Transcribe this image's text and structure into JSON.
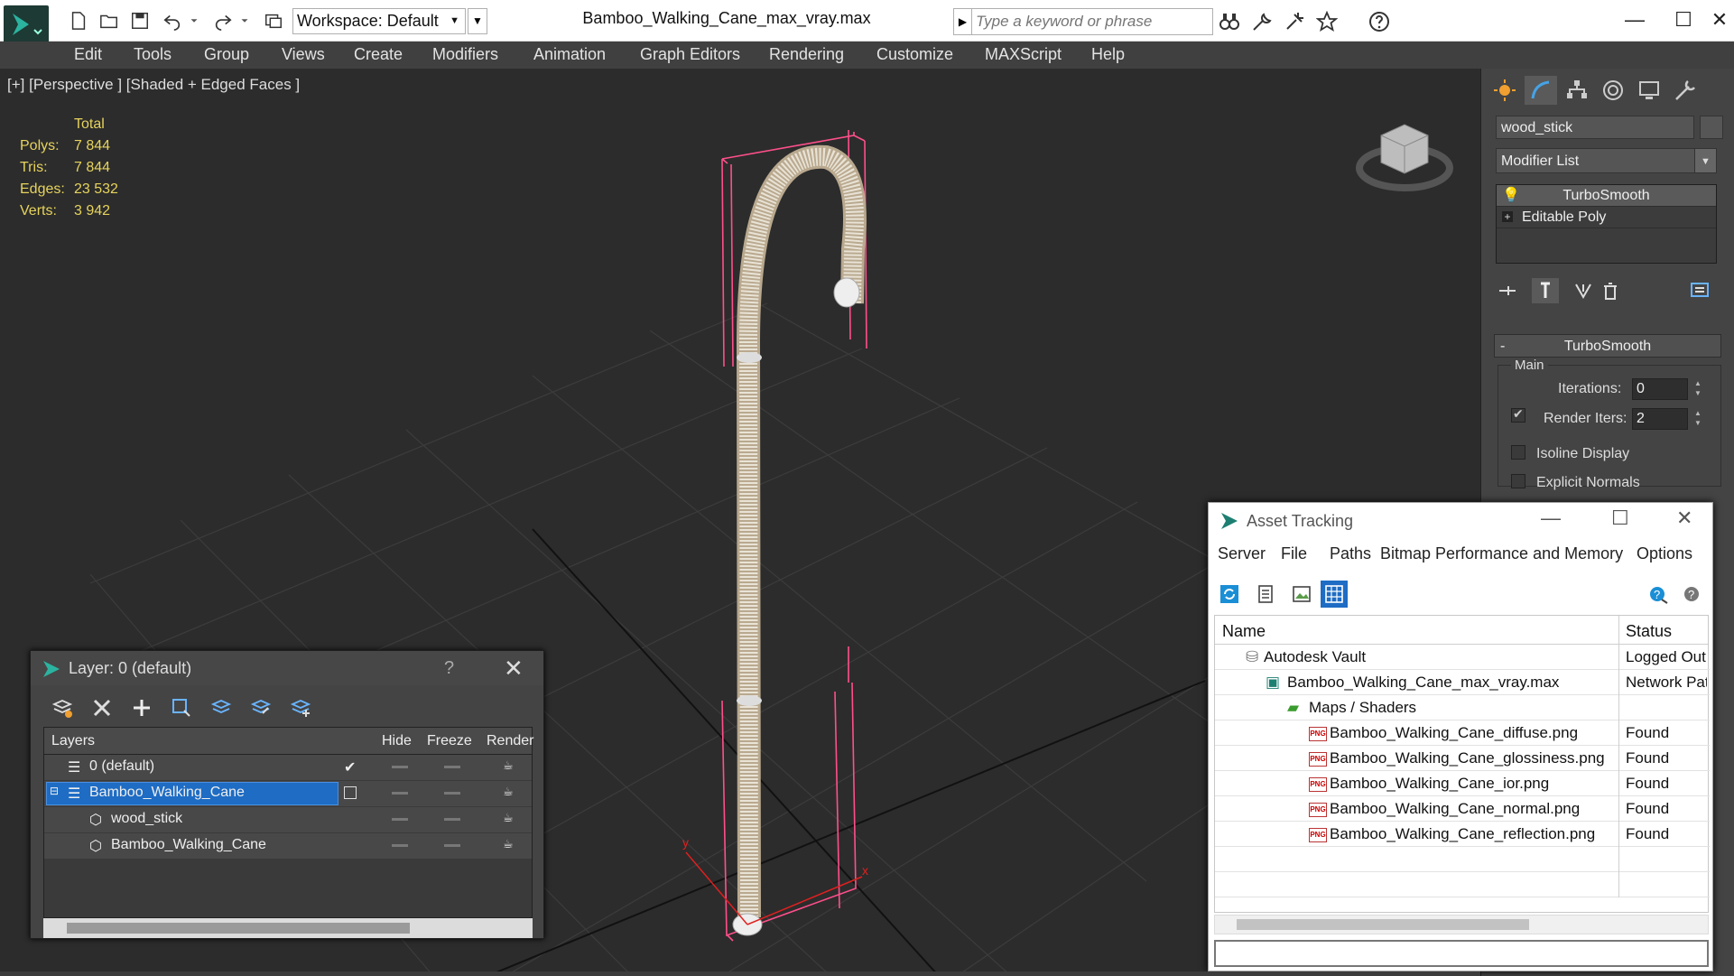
{
  "titlebar": {
    "workspace": "Workspace: Default",
    "document_title": "Bamboo_Walking_Cane_max_vray.max",
    "search_placeholder": "Type a keyword or phrase"
  },
  "menubar": [
    "Edit",
    "Tools",
    "Group",
    "Views",
    "Create",
    "Modifiers",
    "Animation",
    "Graph Editors",
    "Rendering",
    "Customize",
    "MAXScript",
    "Help"
  ],
  "viewport": {
    "label": "[+] [Perspective ] [Shaded + Edged Faces ]",
    "stats": {
      "header": "Total",
      "rows": [
        {
          "label": "Polys:",
          "value": "7 844"
        },
        {
          "label": "Tris:",
          "value": "7 844"
        },
        {
          "label": "Edges:",
          "value": "23 532"
        },
        {
          "label": "Verts:",
          "value": "3 942"
        }
      ]
    }
  },
  "command_panel": {
    "object_name": "wood_stick",
    "modifier_list": "Modifier List",
    "stack": [
      "TurboSmooth",
      "Editable Poly"
    ],
    "rollout_title": "TurboSmooth",
    "rollout_minus": "-",
    "group_main": "Main",
    "iterations_label": "Iterations:",
    "iterations_value": "0",
    "render_iters_label": "Render Iters:",
    "render_iters_value": "2",
    "isoline_label": "Isoline Display",
    "explicit_normals_label": "Explicit Normals"
  },
  "layer_window": {
    "title": "Layer: 0 (default)",
    "help": "?",
    "columns": {
      "layers": "Layers",
      "hide": "Hide",
      "freeze": "Freeze",
      "render": "Render"
    },
    "rows": [
      {
        "name": "0 (default)"
      },
      {
        "name": "Bamboo_Walking_Cane"
      },
      {
        "name": "wood_stick"
      },
      {
        "name": "Bamboo_Walking_Cane"
      }
    ]
  },
  "asset_window": {
    "title": "Asset Tracking",
    "menu": [
      "Server",
      "File",
      "Paths",
      "Bitmap Performance and Memory",
      "Options"
    ],
    "columns": {
      "name": "Name",
      "status": "Status"
    },
    "png_badge": "PNG",
    "rows": [
      {
        "name": "Autodesk Vault",
        "status": "Logged Out"
      },
      {
        "name": "Bamboo_Walking_Cane_max_vray.max",
        "status": "Network Path"
      },
      {
        "name": "Maps / Shaders",
        "status": ""
      },
      {
        "name": "Bamboo_Walking_Cane_diffuse.png",
        "status": "Found"
      },
      {
        "name": "Bamboo_Walking_Cane_glossiness.png",
        "status": "Found"
      },
      {
        "name": "Bamboo_Walking_Cane_ior.png",
        "status": "Found"
      },
      {
        "name": "Bamboo_Walking_Cane_normal.png",
        "status": "Found"
      },
      {
        "name": "Bamboo_Walking_Cane_reflection.png",
        "status": "Found"
      }
    ]
  },
  "colors": {
    "accent": "#1e6cc4",
    "stats": "#e6d35d",
    "viewport_bg": "#2c2c2c",
    "panel_bg": "#444444",
    "bbox": "#ff4f8b"
  }
}
